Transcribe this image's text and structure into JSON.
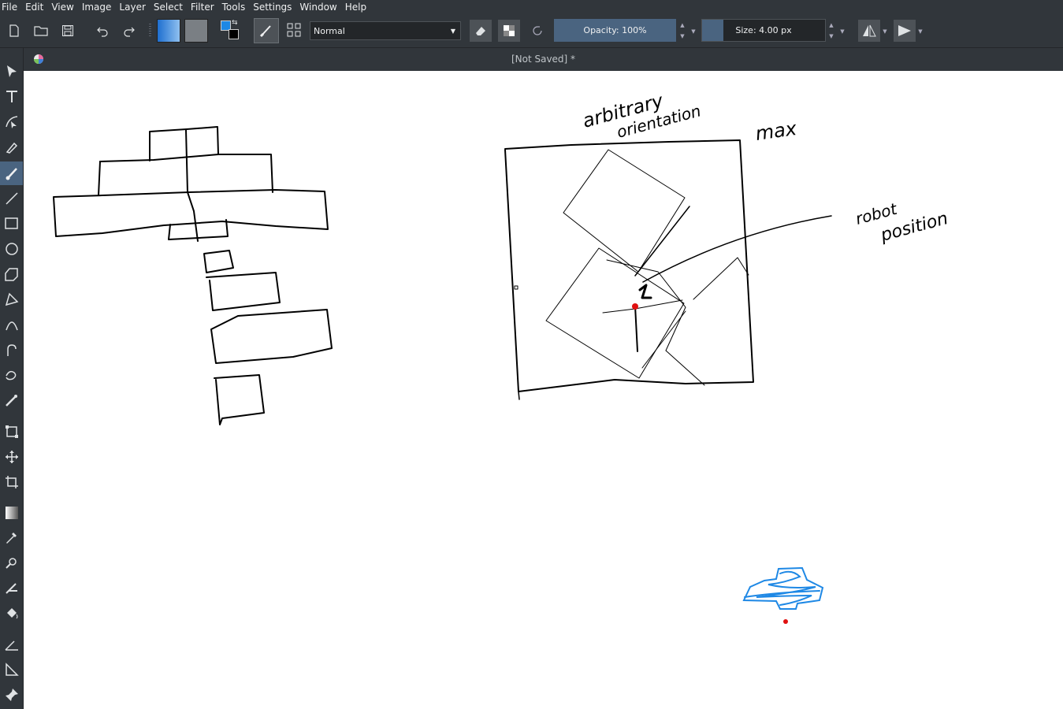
{
  "menu": [
    "File",
    "Edit",
    "View",
    "Image",
    "Layer",
    "Select",
    "Filter",
    "Tools",
    "Settings",
    "Window",
    "Help"
  ],
  "toolbar": {
    "blend_mode": "Normal",
    "opacity_label": "Opacity: 100%",
    "size_label": "Size: 4.00 px",
    "foreground_color": "#1e88e5",
    "background_color": "#000000"
  },
  "document": {
    "title": "[Not Saved]  *"
  },
  "canvas": {
    "annotations": {
      "arbitrary": "arbitrary",
      "orientation": "orientation",
      "max": "max",
      "robot": "robot",
      "position": "position"
    }
  },
  "colors": {
    "accent": "#4a6480",
    "panel": "#31363b",
    "stroke": "#000000",
    "marker_red": "#e01010",
    "blue_scribble": "#1e88e5"
  },
  "tools": [
    "select-shapes-icon",
    "text-icon",
    "edit-shapes-icon",
    "calligraphy-icon",
    "freehand-brush-icon",
    "line-icon",
    "rectangle-icon",
    "ellipse-icon",
    "polygon-icon",
    "polyline-icon",
    "bezier-icon",
    "freehand-path-icon",
    "dynamic-brush-icon",
    "multibrush-icon",
    "transform-icon",
    "move-icon",
    "crop-icon",
    "gradient-icon",
    "color-picker-icon",
    "smart-patch-icon",
    "fill-icon",
    "reference-icon",
    "measure-icon",
    "assistant-icon",
    "pin-icon"
  ]
}
